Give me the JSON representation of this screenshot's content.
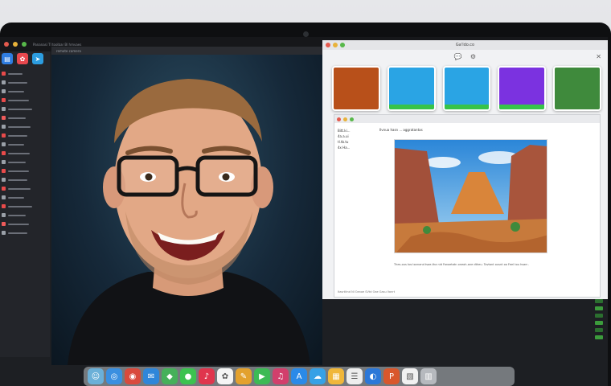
{
  "window": {
    "title": "Ga'ldo.co",
    "menu_text": "Pananasi  Tl toolbar   Bl hmvaes"
  },
  "video_panel": {
    "bar_text": "remote camera"
  },
  "sidebar": {
    "app_tiles": [
      {
        "icon": "finder-icon",
        "color": "#2f7de1",
        "glyph": "▤"
      },
      {
        "icon": "photos-icon",
        "color": "#e8484e",
        "glyph": "✿"
      },
      {
        "icon": "arrow-app-icon",
        "color": "#2c9de0",
        "glyph": "➤"
      }
    ],
    "rows": [
      {
        "icon_color": "#e84a4a",
        "width": 18
      },
      {
        "icon_color": "#9aa0a8",
        "width": 24
      },
      {
        "icon_color": "#9aa0a8",
        "width": 20
      },
      {
        "icon_color": "#e84a4a",
        "width": 26
      },
      {
        "icon_color": "#9aa0a8",
        "width": 30
      },
      {
        "icon_color": "#ee5b5b",
        "width": 22
      },
      {
        "icon_color": "#9aa0a8",
        "width": 28
      },
      {
        "icon_color": "#e84a4a",
        "width": 24
      },
      {
        "icon_color": "#9aa0a8",
        "width": 20
      },
      {
        "icon_color": "#e84a4a",
        "width": 27
      },
      {
        "icon_color": "#9aa0a8",
        "width": 22
      },
      {
        "icon_color": "#e84a4a",
        "width": 26
      },
      {
        "icon_color": "#9aa0a8",
        "width": 24
      },
      {
        "icon_color": "#e84a4a",
        "width": 28
      },
      {
        "icon_color": "#9aa0a8",
        "width": 20
      },
      {
        "icon_color": "#e84a4a",
        "width": 30
      },
      {
        "icon_color": "#9aa0a8",
        "width": 22
      },
      {
        "icon_color": "#ee5b5b",
        "width": 26
      },
      {
        "icon_color": "#9aa0a8",
        "width": 24
      }
    ]
  },
  "app_window": {
    "tab_icons": [
      "chat-icon",
      "close-icon"
    ],
    "thumbnails": [
      {
        "name": "thumb-warrior",
        "bg": "#b8501a",
        "label": ""
      },
      {
        "name": "thumb-blue",
        "bg": "#2aa4e4",
        "label": ""
      },
      {
        "name": "thumb-blue-2",
        "bg": "#2aa4e4",
        "label": ""
      },
      {
        "name": "thumb-purple",
        "bg": "#7b32e0",
        "label": ""
      },
      {
        "name": "thumb-character",
        "bg": "#3f8a3c",
        "label": ""
      }
    ]
  },
  "browser": {
    "header": "Ilvnua hasn ... aggratantas",
    "left_lines": [
      "Bitt.ki...",
      "4a.a.ui",
      "tl.tb.tu",
      "4x Ha..."
    ],
    "caption": "Thes-ous tos tovnand tsae-tha nid Fanaetatn oneoh-ane dtheu. Tovtant ousnt oo Feel tou hsae:.",
    "footer": "Itasrtitnd  Nl  Oanoe  SVtd  Oae  Gasu  Vanrt"
  },
  "dock": {
    "icons": [
      {
        "name": "finder-icon",
        "color": "#6bb0d8",
        "glyph": "☺"
      },
      {
        "name": "safari-icon",
        "color": "#3a8fe0",
        "glyph": "◎"
      },
      {
        "name": "chrome-icon",
        "color": "#d94a3d",
        "glyph": "◉"
      },
      {
        "name": "mail-icon",
        "color": "#2f86d9",
        "glyph": "✉"
      },
      {
        "name": "maps-icon",
        "color": "#46b05a",
        "glyph": "◆"
      },
      {
        "name": "messages-icon",
        "color": "#3cc24f",
        "glyph": "●"
      },
      {
        "name": "music-icon",
        "color": "#e0354d",
        "glyph": "♪"
      },
      {
        "name": "photos-icon",
        "color": "#f5f5f5",
        "glyph": "✿"
      },
      {
        "name": "notes-icon",
        "color": "#e3a12e",
        "glyph": "✎"
      },
      {
        "name": "facetime-icon",
        "color": "#3dba55",
        "glyph": "▶"
      },
      {
        "name": "itunes-icon",
        "color": "#d23f6c",
        "glyph": "♫"
      },
      {
        "name": "appstore-icon",
        "color": "#2a8ae8",
        "glyph": "A"
      },
      {
        "name": "weather-icon",
        "color": "#36a1e6",
        "glyph": "☁"
      },
      {
        "name": "calendar-icon",
        "color": "#f0b73a",
        "glyph": "▦"
      },
      {
        "name": "reminders-icon",
        "color": "#eeeeee",
        "glyph": "☰"
      },
      {
        "name": "browser-icon",
        "color": "#2c78d8",
        "glyph": "◐"
      },
      {
        "name": "powerpoint-icon",
        "color": "#d9572c",
        "glyph": "P"
      },
      {
        "name": "preview-icon",
        "color": "#f1f1f1",
        "glyph": "▧"
      },
      {
        "name": "trash-icon",
        "color": "#b6b9be",
        "glyph": "▥"
      }
    ]
  }
}
